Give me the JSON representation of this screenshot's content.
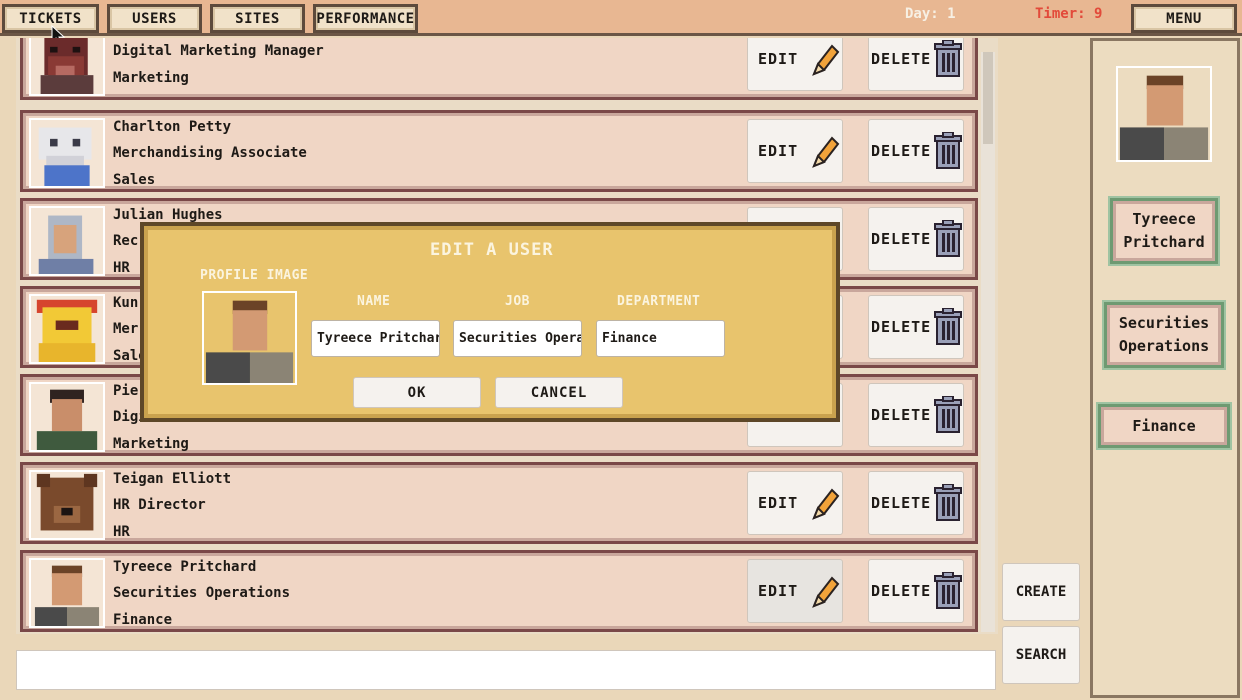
{
  "nav": {
    "tabs": [
      {
        "label": "TICKETS"
      },
      {
        "label": "USERS"
      },
      {
        "label": "SITES"
      },
      {
        "label": "PERFORMANCE"
      }
    ],
    "day": "Day: 1",
    "timer": "Timer: 9",
    "menu": "MENU"
  },
  "users": [
    {
      "name": "",
      "job": "Digital Marketing Manager",
      "department": "Marketing",
      "avatar": "boar-portrait"
    },
    {
      "name": "Charlton Petty",
      "job": "Merchandising Associate",
      "department": "Sales",
      "avatar": "skull-creature-portrait"
    },
    {
      "name": "Julian Hughes",
      "job": "Recr",
      "department": "HR",
      "avatar": "hooded-old-man-portrait"
    },
    {
      "name": "Kun",
      "job": "Mer",
      "department": "Sale",
      "avatar": "yellow-robot-portrait"
    },
    {
      "name": "Pier",
      "job": "Digi",
      "department": "Marketing",
      "avatar": "dark-hair-man-portrait"
    },
    {
      "name": "Teigan Elliott",
      "job": "HR Director",
      "department": "HR",
      "avatar": "bear-portrait"
    },
    {
      "name": "Tyreece Pritchard",
      "job": "Securities Operations",
      "department": "Finance",
      "avatar": "brown-hair-man-portrait"
    }
  ],
  "row_buttons": {
    "edit": "EDIT",
    "delete": "DELETE"
  },
  "actions": {
    "create": "CREATE",
    "search": "SEARCH",
    "search_value": ""
  },
  "detail": {
    "name_lines": [
      "Tyreece",
      "Pritchard"
    ],
    "job_lines": [
      "Securities",
      "Operations"
    ],
    "department": "Finance"
  },
  "modal": {
    "title": "EDIT A USER",
    "profile_image_label": "PROFILE IMAGE",
    "name_label": "NAME",
    "job_label": "JOB",
    "department_label": "DEPARTMENT",
    "name_value": "Tyreece Pritchar",
    "job_value": "Securities Operat",
    "department_value": "Finance",
    "ok": "OK",
    "cancel": "CANCEL"
  },
  "colors": {
    "row_border": "#7a4848",
    "modal_bg": "#e8c46d",
    "timer": "#e24a3a",
    "selected_frame": "#6e9a72"
  }
}
